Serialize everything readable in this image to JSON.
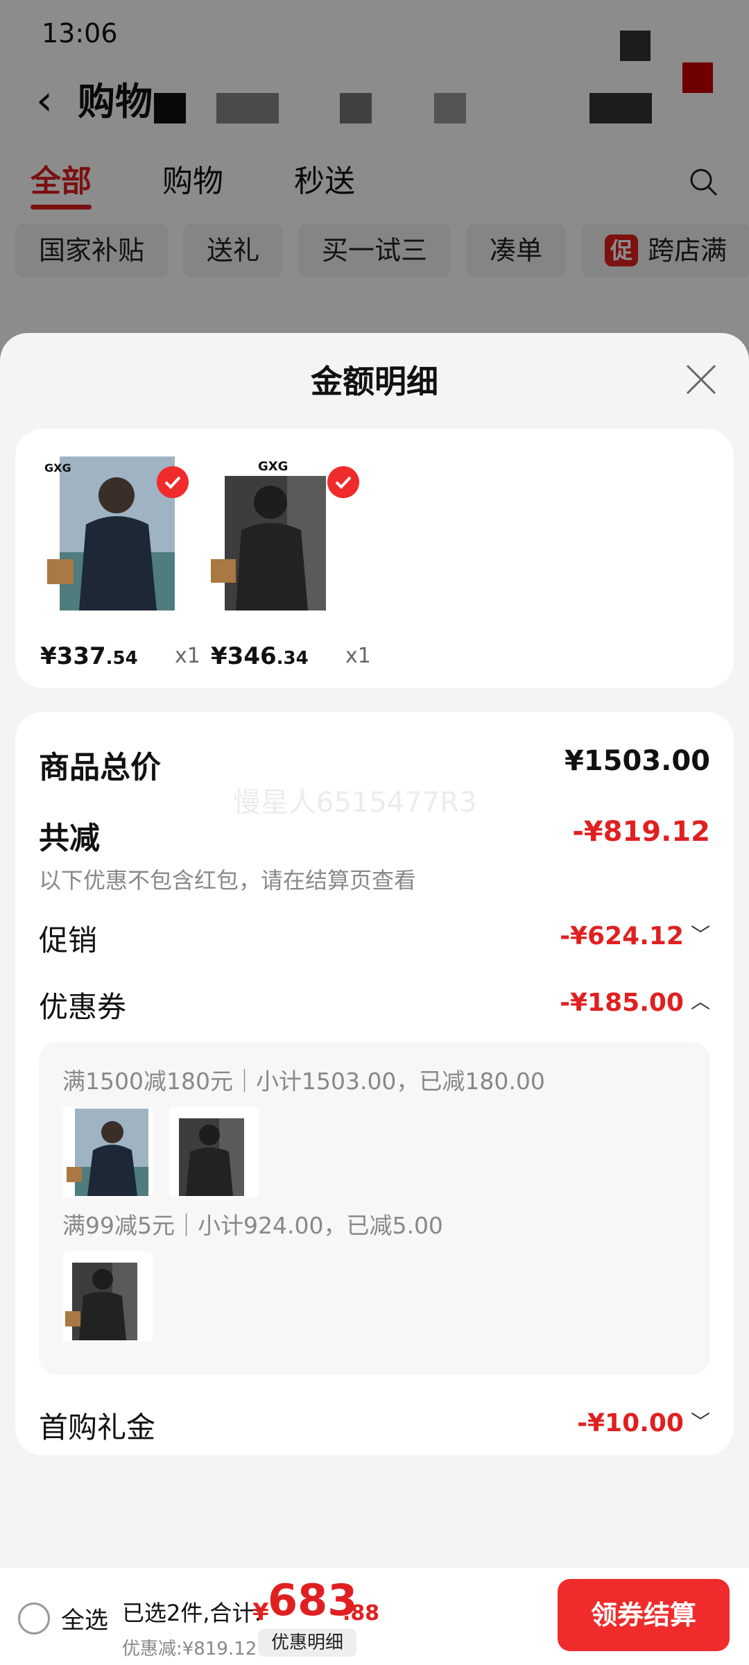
{
  "status": {
    "time": "13:06"
  },
  "nav": {
    "back": "‹",
    "title": "购物"
  },
  "tabs": [
    "全部",
    "购物",
    "秒送"
  ],
  "chips": [
    "国家补贴",
    "送礼",
    "买一试三",
    "凑单"
  ],
  "chip_last": {
    "badge": "促",
    "label": "跨店满"
  },
  "sheet": {
    "title": "金额明细"
  },
  "products": [
    {
      "brand": "GXG",
      "price_int": "¥337",
      "price_dec": ".54",
      "qty": "x1"
    },
    {
      "brand": "GXG",
      "price_int": "¥346",
      "price_dec": ".34",
      "qty": "x1"
    }
  ],
  "summary": {
    "goods_total_label": "商品总价",
    "goods_total": "¥1503.00",
    "watermark": "慢星人6515477R3",
    "reduced_label": "共减",
    "reduced": "-¥819.12",
    "reduced_note": "以下优惠不包含红包，请在结算页查看",
    "promo_label": "促销",
    "promo": "-¥624.12",
    "coupon_label": "优惠券",
    "coupon": "-¥185.00",
    "coupon_lines": [
      "满1500减180元｜小计1503.00，已减180.00",
      "满99减5元｜小计924.00，已减5.00"
    ],
    "gift_label": "首购礼金",
    "gift": "-¥10.00"
  },
  "bottom": {
    "select_all": "全选",
    "selected": "已选2件,合计:",
    "currency": "¥",
    "total_int": "683",
    "total_dec": ".88",
    "discount": "优惠减:¥819.12",
    "detail": "优惠明细",
    "checkout": "领券结算"
  },
  "colors": {
    "accent": "#e02020",
    "button": "#f02b2b"
  }
}
